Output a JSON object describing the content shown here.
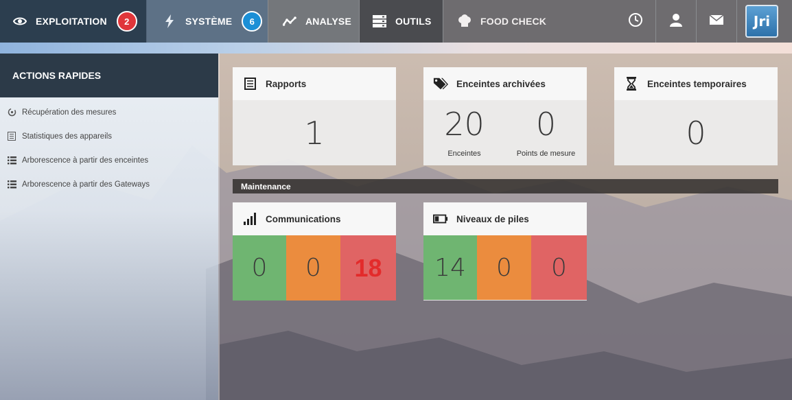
{
  "nav": {
    "items": [
      {
        "label": "EXPLOITATION",
        "badge": "2",
        "icon": "eye-icon"
      },
      {
        "label": "SYSTÈME",
        "badge": "6",
        "icon": "bolt-icon"
      },
      {
        "label": "ANALYSE",
        "icon": "line-chart-icon"
      },
      {
        "label": "OUTILS",
        "icon": "server-icon"
      },
      {
        "label": "FOOD CHECK",
        "icon": "chef-hat-icon"
      }
    ],
    "right_icons": [
      "clock-icon",
      "user-icon",
      "mail-icon"
    ],
    "logo_text": "Jri"
  },
  "sidebar": {
    "title": "ACTIONS RAPIDES",
    "items": [
      {
        "label": "Récupération des mesures",
        "icon": "refresh-icon"
      },
      {
        "label": "Statistiques des appareils",
        "icon": "report-icon"
      },
      {
        "label": "Arborescence à partir des enceintes",
        "icon": "list-icon"
      },
      {
        "label": "Arborescence à partir des Gateways",
        "icon": "list-icon"
      }
    ]
  },
  "cards": {
    "rapports": {
      "title": "Rapports",
      "value": "1",
      "icon": "report-icon"
    },
    "archivees": {
      "title": "Enceintes archivées",
      "icon": "tags-icon",
      "stats": [
        {
          "value": "20",
          "label": "Enceintes"
        },
        {
          "value": "0",
          "label": "Points de mesure"
        }
      ]
    },
    "temporaires": {
      "title": "Enceintes temporaires",
      "value": "0",
      "icon": "hourglass-icon"
    }
  },
  "maintenance": {
    "title": "Maintenance",
    "communications": {
      "title": "Communications",
      "icon": "signal-icon",
      "values": [
        "0",
        "0",
        "18"
      ]
    },
    "piles": {
      "title": "Niveaux de piles",
      "icon": "battery-icon",
      "values": [
        "14",
        "0",
        "0"
      ]
    }
  },
  "colors": {
    "green": "#6fb571",
    "orange": "#eb8c3e",
    "red": "#e06464",
    "nav_dark": "#2c3e4f",
    "badge_red": "#e0363a",
    "badge_blue": "#1b8fd6"
  }
}
